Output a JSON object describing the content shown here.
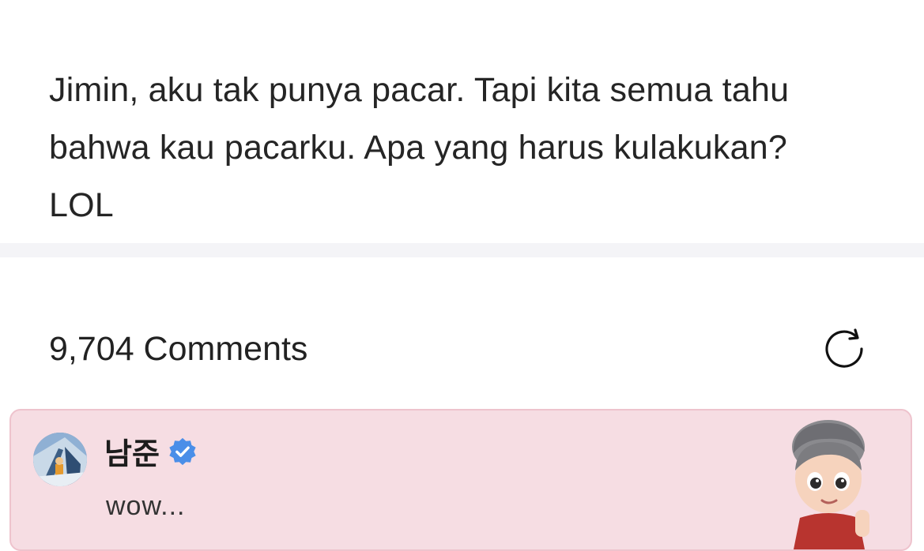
{
  "post": {
    "lines": [
      "Jimin, aku tak punya pacar. Tapi kita semua tahu",
      "bahwa kau pacarku. Apa yang harus kulakukan?",
      "LOL"
    ]
  },
  "comments": {
    "count_label": "9,704 Comments",
    "refresh_icon": "refresh-icon",
    "items": [
      {
        "author": "남준",
        "verified": true,
        "text": "wow...",
        "avatar_icon": "profile-photo",
        "sticker_icon": "cartoon-character-sticker"
      }
    ]
  },
  "colors": {
    "card_bg": "#f6dde3",
    "card_border": "#eec3cd",
    "verified_blue": "#4a8ee8",
    "divider": "#f4f4f7"
  }
}
